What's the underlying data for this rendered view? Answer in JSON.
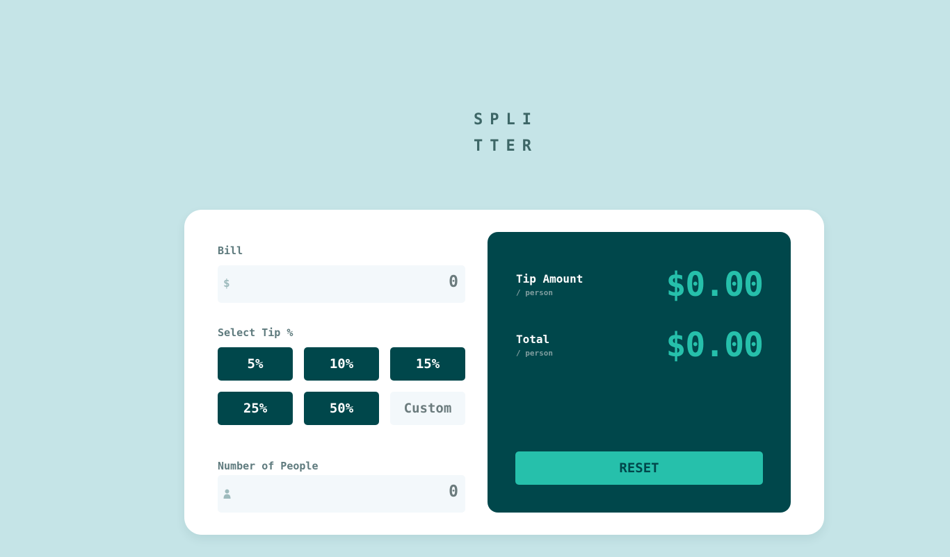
{
  "logo": {
    "line1": "SPLI",
    "line2": "TTER"
  },
  "bill": {
    "label": "Bill",
    "prefix_symbol": "$",
    "value": "0"
  },
  "tip": {
    "label": "Select Tip %",
    "options": [
      "5%",
      "10%",
      "15%",
      "25%",
      "50%"
    ],
    "custom_placeholder": "Custom"
  },
  "people": {
    "label": "Number of People",
    "value": "0",
    "icon": "person-icon"
  },
  "results": {
    "tip_amount": {
      "label": "Tip Amount",
      "sub": "/ person",
      "value": "$0.00"
    },
    "total": {
      "label": "Total",
      "sub": "/ person",
      "value": "$0.00"
    },
    "reset_label": "RESET"
  },
  "colors": {
    "background": "#c5e4e7",
    "dark_cyan": "#00474b",
    "accent": "#26c0ab",
    "input_bg": "#f3f8fb"
  }
}
